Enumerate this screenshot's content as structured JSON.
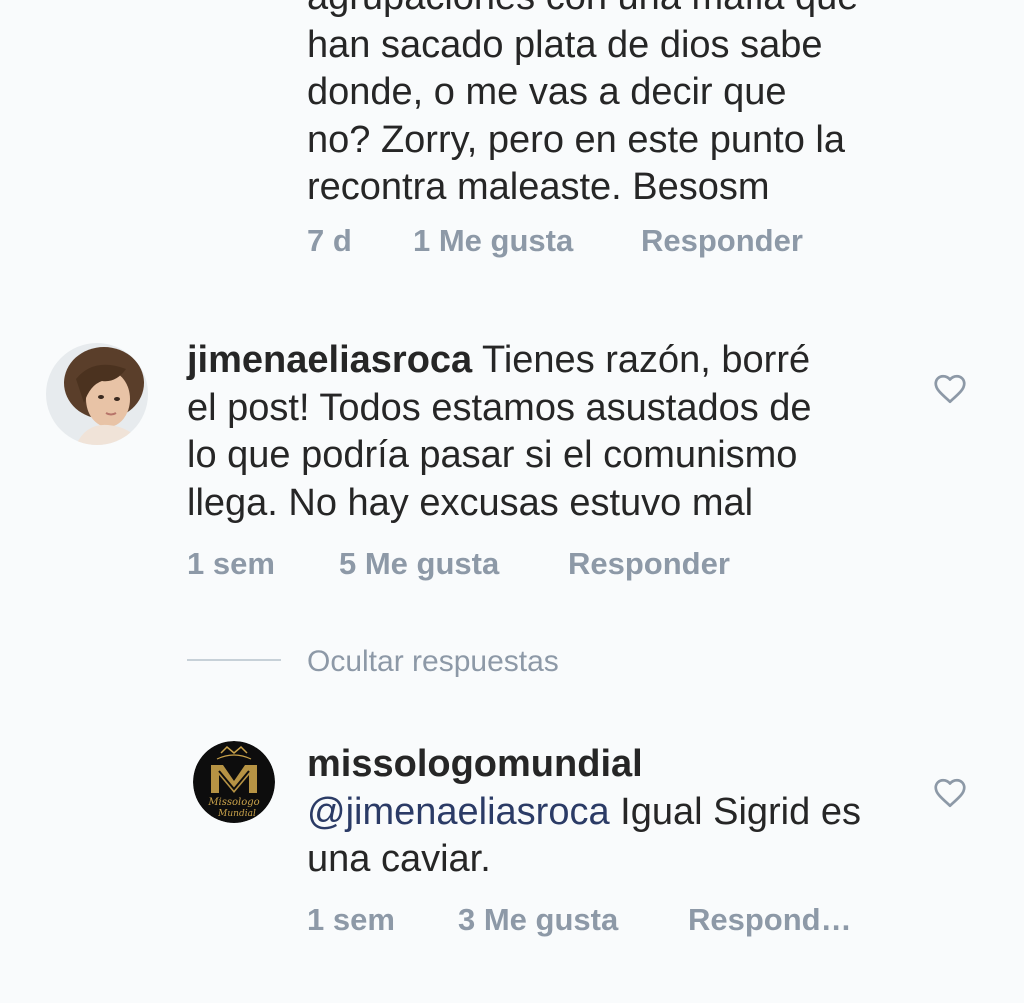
{
  "comment1": {
    "lines": [
      "agrupaciones con una mafia que",
      "han sacado plata de dios sabe",
      "donde, o me vas a decir que",
      "no? Zorry, pero en este punto la",
      "recontra maleaste. Besosm"
    ],
    "time": "7 d",
    "likes": "1 Me gusta",
    "reply": "Responder"
  },
  "comment2": {
    "username": "jimenaeliasroca",
    "first_line_rest": " Tienes razón, borré",
    "lines": [
      "el post! Todos estamos asustados de",
      "lo que podría pasar si el comunismo",
      "llega. No hay excusas estuvo mal"
    ],
    "time": "1 sem",
    "likes": "5 Me gusta",
    "reply": "Responder",
    "avatar_icon": "user-photo-avatar",
    "like_icon": "heart-outline-icon"
  },
  "replies_toggle": "Ocultar respuestas",
  "comment3": {
    "username": "missologomundial",
    "mention": "@jimenaeliasroca",
    "first_line_rest": " Igual Sigrid es",
    "lines": [
      "una caviar."
    ],
    "time": "1 sem",
    "likes": "3 Me gusta",
    "reply": "Respond…",
    "avatar_icon": "missologo-logo-avatar",
    "logo_text_1": "Missologo",
    "logo_text_2": "Mundial",
    "like_icon": "heart-outline-icon"
  },
  "colors": {
    "background": "#f9fbfc",
    "text": "#262626",
    "meta": "#8d99a7",
    "mention": "#2b3b66",
    "logo_gold": "#c9a24a"
  }
}
